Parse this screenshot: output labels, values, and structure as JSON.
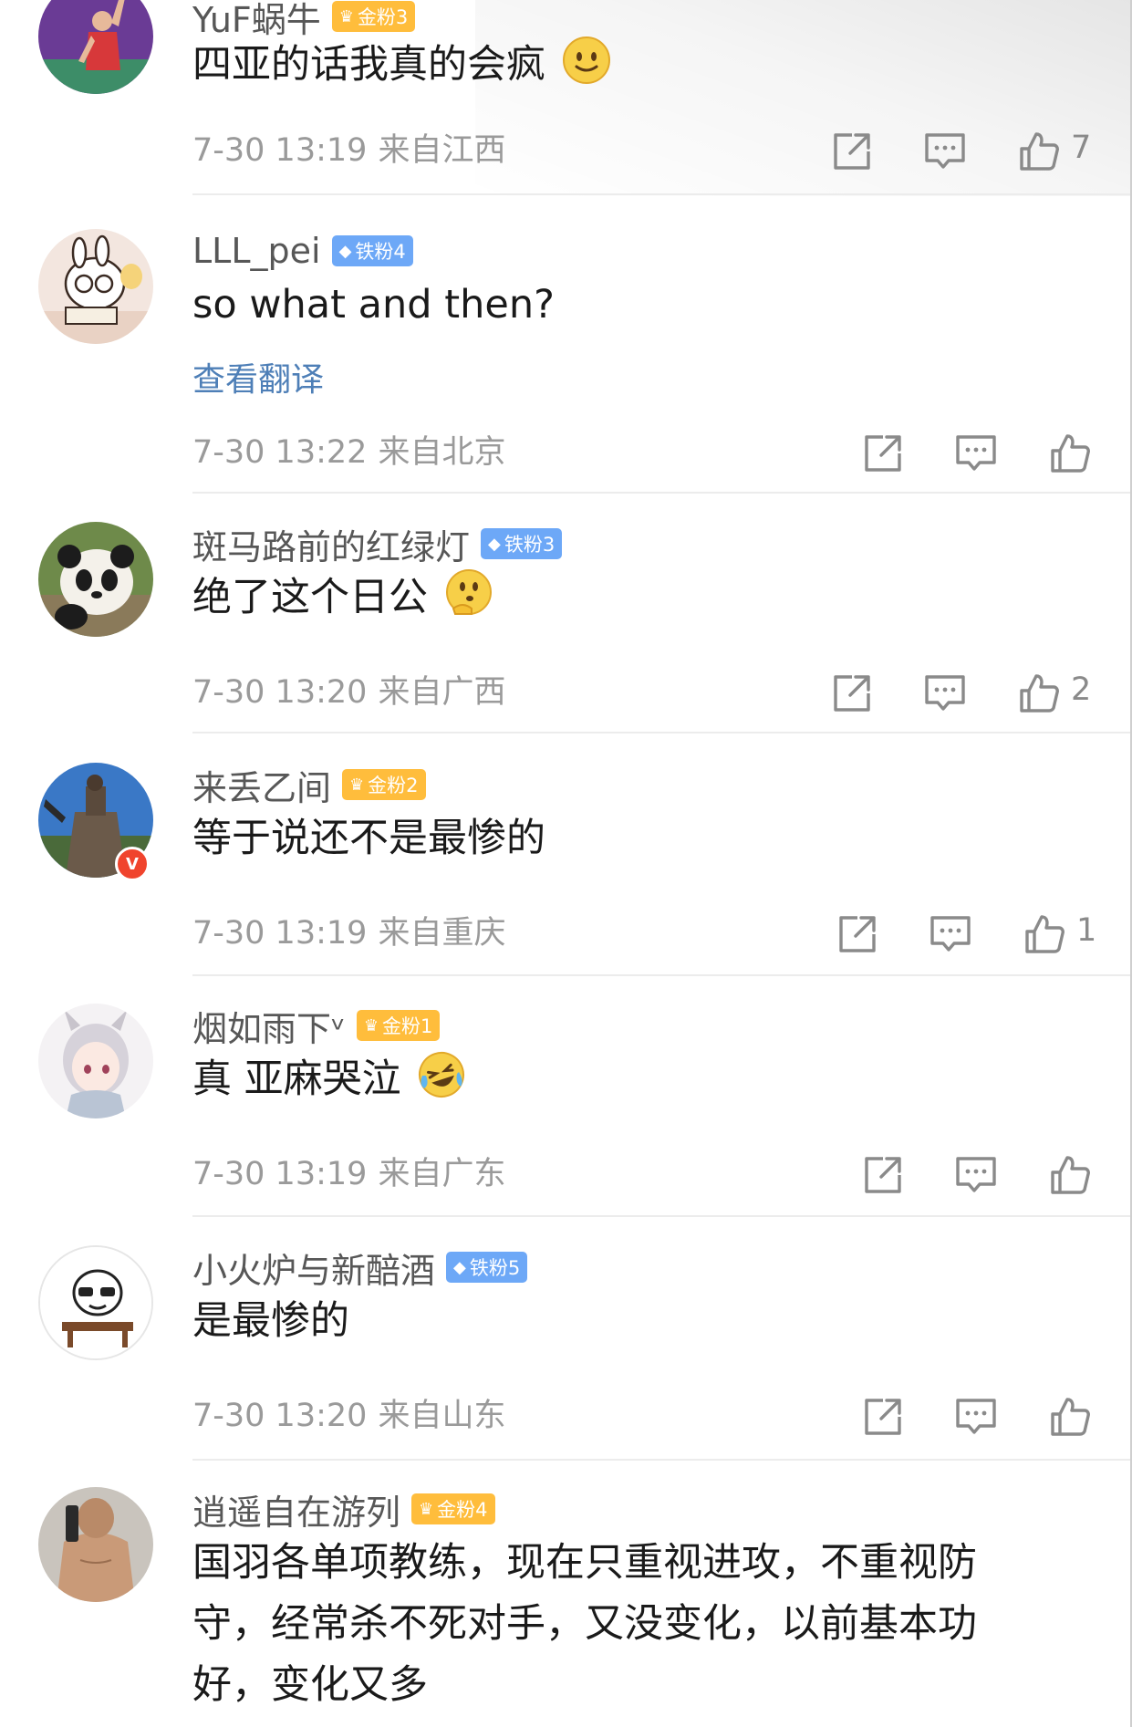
{
  "comments": [
    {
      "username": "YuF蜗牛",
      "badge": {
        "type": "gold",
        "label": "金粉3"
      },
      "content": "四亚的话我真的会疯",
      "emoji": "smile-emoji",
      "time": "7-30 13:19",
      "location": "来自江西",
      "likes": "7"
    },
    {
      "username": "LLL_pei",
      "badge": {
        "type": "iron",
        "label": "铁粉4"
      },
      "content": "so what and then?",
      "translate": "查看翻译",
      "time": "7-30 13:22",
      "location": "来自北京",
      "likes": ""
    },
    {
      "username": "斑马路前的红绿灯",
      "badge": {
        "type": "iron",
        "label": "铁粉3"
      },
      "content": "绝了这个日公",
      "emoji": "thinking-emoji",
      "time": "7-30 13:20",
      "location": "来自广西",
      "likes": "2"
    },
    {
      "username": "来丢乙间",
      "badge": {
        "type": "gold",
        "label": "金粉2"
      },
      "content": "等于说还不是最惨的",
      "verified": "V",
      "time": "7-30 13:19",
      "location": "来自重庆",
      "likes": "1"
    },
    {
      "username": "烟如雨下ᵛ",
      "badge": {
        "type": "gold",
        "label": "金粉1"
      },
      "content": "真 亚麻哭泣",
      "emoji": "laugh-cry-emoji",
      "time": "7-30 13:19",
      "location": "来自广东",
      "likes": ""
    },
    {
      "username": "小火炉与新醅酒",
      "badge": {
        "type": "iron",
        "label": "铁粉5"
      },
      "content": "是最惨的",
      "time": "7-30 13:20",
      "location": "来自山东",
      "likes": ""
    },
    {
      "username": "逍遥自在游列",
      "badge": {
        "type": "gold",
        "label": "金粉4"
      },
      "content": "国羽各单项教练，现在只重视进攻，不重视防守，经常杀不死对手，又没变化，以前基本功好，变化又多"
    }
  ],
  "icons": {
    "gold_badge": "crown-icon",
    "iron_badge": "diamond-icon",
    "repost": "repost-icon",
    "reply": "comment-icon",
    "like": "thumbs-up-icon"
  },
  "colors": {
    "gold_badge": "#ffbd3c",
    "iron_badge": "#6da8f7",
    "link": "#4e7fb7",
    "meta": "#9a9a9a",
    "verified": "#f0442d"
  }
}
